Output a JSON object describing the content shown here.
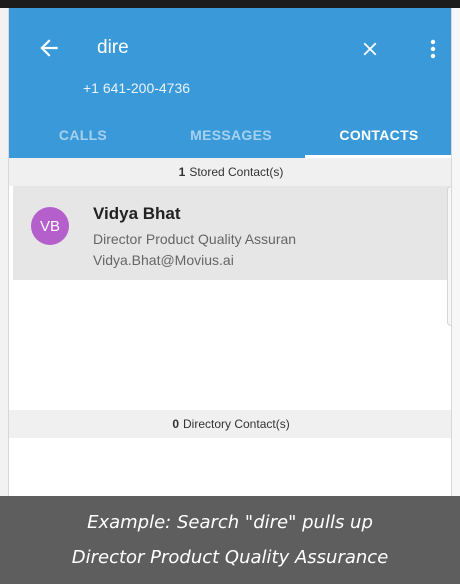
{
  "search": {
    "query": "dire",
    "back_icon": "arrow-left-icon",
    "clear_icon": "close-icon",
    "menu_icon": "more-vert-icon"
  },
  "caller_id": "+1 641-200-4736",
  "tabs": [
    {
      "label": "CALLS",
      "active": false
    },
    {
      "label": "MESSAGES",
      "active": false
    },
    {
      "label": "CONTACTS",
      "active": true
    }
  ],
  "stored_contacts": {
    "count": "1",
    "label": "Stored Contact(s)",
    "items": [
      {
        "initials": "VB",
        "name": "Vidya Bhat",
        "title": "Director Product Quality Assuran",
        "email": "Vidya.Bhat@Movius.ai"
      }
    ]
  },
  "directory_contacts": {
    "count": "0",
    "label": "Directory Contact(s)"
  },
  "caption": {
    "line1": "Example: Search \"dire\" pulls up",
    "line2": "Director Product Quality Assurance"
  },
  "colors": {
    "appbar": "#3a9ad9",
    "avatar": "#b45fcb",
    "caption_bg": "#5e5e5e"
  }
}
